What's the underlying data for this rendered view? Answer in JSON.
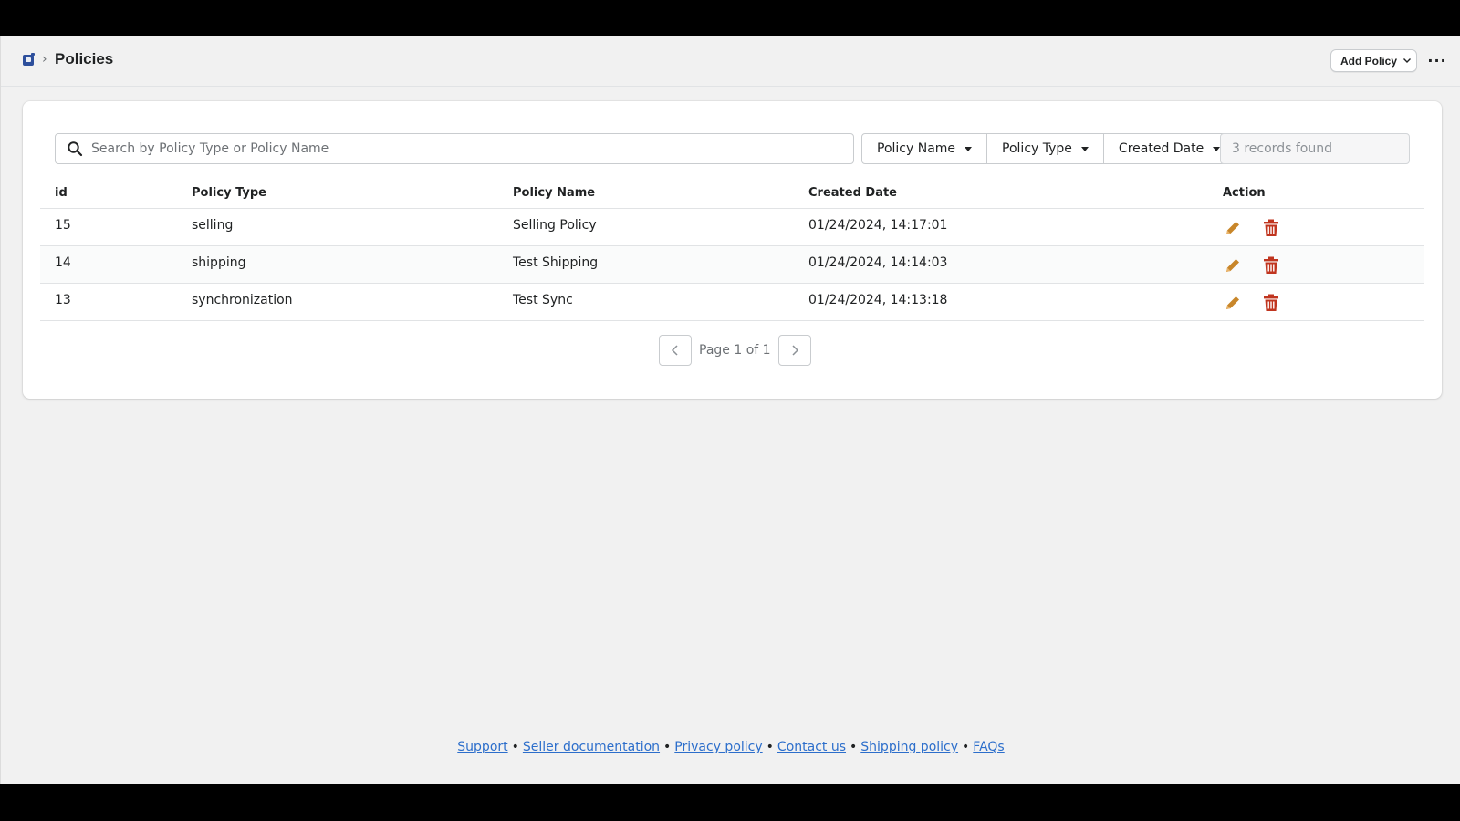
{
  "header": {
    "breadcrumb_sep": "›",
    "title": "Policies",
    "add_button": "Add Policy",
    "more_label": "···"
  },
  "search": {
    "placeholder": "Search by Policy Type or Policy Name"
  },
  "filters": [
    {
      "label": "Policy Name"
    },
    {
      "label": "Policy Type"
    },
    {
      "label": "Created Date"
    }
  ],
  "records_text": "3 records found",
  "table": {
    "columns": [
      "id",
      "Policy Type",
      "Policy Name",
      "Created Date",
      "Action"
    ],
    "rows": [
      {
        "id": "15",
        "type": "selling",
        "name": "Selling Policy",
        "date": "01/24/2024, 14:17:01"
      },
      {
        "id": "14",
        "type": "shipping",
        "name": "Test Shipping",
        "date": "01/24/2024, 14:14:03"
      },
      {
        "id": "13",
        "type": "synchronization",
        "name": "Test Sync",
        "date": "01/24/2024, 14:13:18"
      }
    ]
  },
  "pagination": {
    "label": "Page 1 of 1"
  },
  "footer": {
    "links": [
      "Support",
      "Seller documentation",
      "Privacy policy",
      "Contact us",
      "Shipping policy",
      "FAQs"
    ],
    "separator": "•"
  },
  "colors": {
    "edit_icon": "#c8862a",
    "delete_icon": "#c0351f",
    "link": "#2c6ecb"
  }
}
